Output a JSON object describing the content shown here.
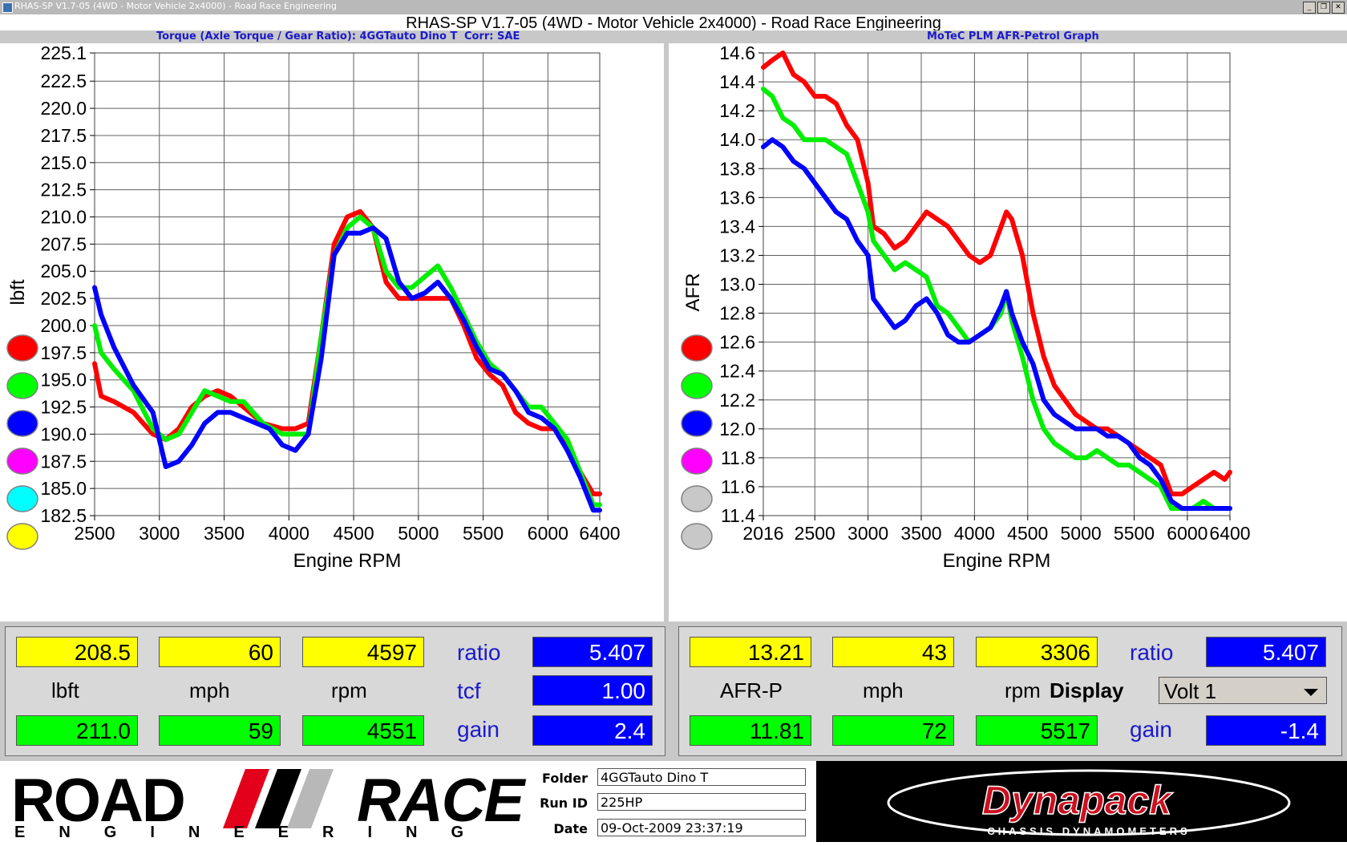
{
  "window": {
    "titlebar_text": "RHAS-SP V1.7-05   (4WD - Motor Vehicle 2x4000) - Road Race Engineering",
    "main_title": "RHAS-SP V1.7-05   (4WD - Motor Vehicle 2x4000) - Road Race Engineering",
    "minimize": "_",
    "restore": "❐",
    "close": "✕"
  },
  "left_header": {
    "title": "Torque (Axle Torque / Gear Ratio): 4GGTauto Dino T",
    "corr": "Corr: SAE"
  },
  "right_header": {
    "title": "MoTeC PLM AFR-Petrol Graph"
  },
  "chart_data": [
    {
      "type": "line",
      "xlabel": "Engine RPM",
      "ylabel": "lbft",
      "xlim": [
        2500,
        6400
      ],
      "ylim": [
        182.5,
        225.1
      ],
      "xticks": [
        2500,
        3000,
        3500,
        4000,
        4500,
        5000,
        5500,
        6000,
        6400
      ],
      "xticklabels": [
        "2500",
        "3000",
        "3500",
        "4000",
        "4500",
        "5000",
        "5500",
        "6000",
        "6400"
      ],
      "yticks": [
        182.5,
        185.0,
        187.5,
        190.0,
        192.5,
        195.0,
        197.5,
        200.0,
        202.5,
        205.0,
        207.5,
        210.0,
        212.5,
        215.0,
        217.5,
        220.0,
        222.5,
        225.1
      ],
      "yticklabels": [
        "182.5",
        "185.0",
        "187.5",
        "190.0",
        "192.5",
        "195.0",
        "197.5",
        "200.0",
        "202.5",
        "205.0",
        "207.5",
        "210.0",
        "212.5",
        "215.0",
        "217.5",
        "220.0",
        "222.5",
        "225.1"
      ],
      "grid": true,
      "series": [
        {
          "color": "#ff0000",
          "x": [
            2500,
            2550,
            2650,
            2800,
            2950,
            3050,
            3150,
            3250,
            3350,
            3450,
            3550,
            3650,
            3800,
            3950,
            4050,
            4150,
            4250,
            4350,
            4450,
            4550,
            4650,
            4750,
            4850,
            4950,
            5050,
            5150,
            5250,
            5350,
            5450,
            5550,
            5650,
            5750,
            5850,
            5950,
            6050,
            6150,
            6250,
            6350,
            6400
          ],
          "y": [
            196.5,
            193.5,
            193,
            192,
            190,
            189.5,
            190.5,
            192.5,
            193.5,
            194,
            193.5,
            192.5,
            191,
            190.5,
            190.5,
            191,
            199,
            207.5,
            210,
            210.5,
            209,
            204,
            202.5,
            202.5,
            202.5,
            202.5,
            202.5,
            200,
            197,
            195.5,
            194.5,
            192,
            191,
            190.5,
            190.5,
            189,
            186.5,
            184.5,
            184.5
          ]
        },
        {
          "color": "#00ee00",
          "x": [
            2500,
            2550,
            2650,
            2800,
            2950,
            3050,
            3150,
            3250,
            3350,
            3450,
            3550,
            3650,
            3800,
            3950,
            4050,
            4150,
            4250,
            4350,
            4450,
            4550,
            4650,
            4750,
            4850,
            4950,
            5050,
            5150,
            5250,
            5350,
            5450,
            5550,
            5650,
            5750,
            5850,
            5950,
            6050,
            6150,
            6250,
            6350,
            6400
          ],
          "y": [
            200,
            197.5,
            196,
            194,
            190.5,
            189.5,
            190,
            192,
            194,
            193.5,
            193,
            193,
            191,
            190,
            190,
            190,
            199,
            206.5,
            209,
            210,
            209,
            205,
            203.5,
            203.5,
            204.5,
            205.5,
            203.5,
            201,
            198.5,
            196.5,
            195.5,
            194,
            192.5,
            192.5,
            191,
            189.5,
            186.5,
            183.5,
            183.5
          ]
        },
        {
          "color": "#0000ff",
          "x": [
            2500,
            2550,
            2650,
            2800,
            2950,
            3050,
            3150,
            3250,
            3350,
            3450,
            3550,
            3650,
            3750,
            3850,
            3950,
            4050,
            4150,
            4250,
            4350,
            4450,
            4550,
            4650,
            4750,
            4850,
            4950,
            5050,
            5150,
            5250,
            5350,
            5450,
            5550,
            5650,
            5750,
            5850,
            5950,
            6050,
            6150,
            6250,
            6350,
            6400
          ],
          "y": [
            203.5,
            201,
            198,
            194.5,
            192,
            187,
            187.5,
            189,
            191,
            192,
            192,
            191.5,
            191,
            190.5,
            189,
            188.5,
            190,
            197,
            206.5,
            208.5,
            208.5,
            209,
            208,
            204,
            202.5,
            203,
            204,
            202.5,
            200.5,
            198,
            196,
            195.5,
            194,
            192,
            191.5,
            190.5,
            188.5,
            186,
            183,
            183
          ]
        }
      ]
    },
    {
      "type": "line",
      "xlabel": "Engine RPM",
      "ylabel": "AFR",
      "xlim": [
        2016,
        6400
      ],
      "ylim": [
        11.4,
        14.6
      ],
      "xticks": [
        2016,
        2500,
        3000,
        3500,
        4000,
        4500,
        5000,
        5500,
        6000,
        6400
      ],
      "xticklabels": [
        "2016",
        "2500",
        "3000",
        "3500",
        "4000",
        "4500",
        "5000",
        "5500",
        "6000",
        "6400"
      ],
      "yticks": [
        11.4,
        11.6,
        11.8,
        12.0,
        12.2,
        12.4,
        12.6,
        12.8,
        13.0,
        13.2,
        13.4,
        13.6,
        13.8,
        14.0,
        14.2,
        14.4,
        14.6
      ],
      "yticklabels": [
        "11.4",
        "11.6",
        "11.8",
        "12.0",
        "12.2",
        "12.4",
        "12.6",
        "12.8",
        "13.0",
        "13.2",
        "13.4",
        "13.6",
        "13.8",
        "14.0",
        "14.2",
        "14.4",
        "14.6"
      ],
      "grid": true,
      "series": [
        {
          "color": "#ff0000",
          "x": [
            2016,
            2100,
            2200,
            2300,
            2400,
            2500,
            2600,
            2700,
            2800,
            2900,
            3000,
            3050,
            3150,
            3250,
            3350,
            3450,
            3550,
            3650,
            3750,
            3850,
            3950,
            4050,
            4150,
            4250,
            4300,
            4350,
            4450,
            4550,
            4650,
            4750,
            4850,
            4950,
            5050,
            5150,
            5250,
            5350,
            5450,
            5550,
            5650,
            5750,
            5850,
            5950,
            6050,
            6150,
            6250,
            6350,
            6400
          ],
          "y": [
            14.5,
            14.55,
            14.6,
            14.45,
            14.4,
            14.3,
            14.3,
            14.25,
            14.1,
            14.0,
            13.7,
            13.4,
            13.35,
            13.25,
            13.3,
            13.4,
            13.5,
            13.45,
            13.4,
            13.3,
            13.2,
            13.15,
            13.2,
            13.4,
            13.5,
            13.45,
            13.2,
            12.8,
            12.5,
            12.3,
            12.2,
            12.1,
            12.05,
            12.0,
            12.0,
            11.95,
            11.9,
            11.85,
            11.8,
            11.75,
            11.55,
            11.55,
            11.6,
            11.65,
            11.7,
            11.65,
            11.7
          ]
        },
        {
          "color": "#00ee00",
          "x": [
            2016,
            2100,
            2200,
            2300,
            2400,
            2500,
            2600,
            2700,
            2800,
            2900,
            3000,
            3050,
            3150,
            3250,
            3350,
            3450,
            3550,
            3650,
            3750,
            3850,
            3950,
            4050,
            4150,
            4250,
            4300,
            4350,
            4450,
            4550,
            4650,
            4750,
            4850,
            4950,
            5050,
            5150,
            5250,
            5350,
            5450,
            5550,
            5650,
            5750,
            5850,
            5950,
            6050,
            6150,
            6250,
            6350,
            6400
          ],
          "y": [
            14.35,
            14.3,
            14.15,
            14.1,
            14.0,
            14.0,
            14.0,
            13.95,
            13.9,
            13.7,
            13.5,
            13.3,
            13.2,
            13.1,
            13.15,
            13.1,
            13.05,
            12.85,
            12.8,
            12.7,
            12.6,
            12.65,
            12.7,
            12.8,
            12.95,
            12.75,
            12.5,
            12.2,
            12.0,
            11.9,
            11.85,
            11.8,
            11.8,
            11.85,
            11.8,
            11.75,
            11.75,
            11.7,
            11.65,
            11.6,
            11.45,
            11.45,
            11.45,
            11.5,
            11.45,
            11.45,
            11.45
          ]
        },
        {
          "color": "#0000ff",
          "x": [
            2016,
            2100,
            2200,
            2300,
            2400,
            2500,
            2600,
            2700,
            2800,
            2900,
            3000,
            3050,
            3150,
            3250,
            3350,
            3450,
            3550,
            3650,
            3750,
            3850,
            3950,
            4050,
            4150,
            4250,
            4300,
            4350,
            4450,
            4550,
            4650,
            4750,
            4850,
            4950,
            5050,
            5150,
            5250,
            5350,
            5450,
            5550,
            5650,
            5750,
            5850,
            5950,
            6050,
            6150,
            6250,
            6350,
            6400
          ],
          "y": [
            13.95,
            14.0,
            13.95,
            13.85,
            13.8,
            13.7,
            13.6,
            13.5,
            13.45,
            13.3,
            13.2,
            12.9,
            12.8,
            12.7,
            12.75,
            12.85,
            12.9,
            12.8,
            12.65,
            12.6,
            12.6,
            12.65,
            12.7,
            12.85,
            12.95,
            12.8,
            12.6,
            12.45,
            12.2,
            12.1,
            12.05,
            12.0,
            12.0,
            12.0,
            11.95,
            11.95,
            11.9,
            11.8,
            11.75,
            11.65,
            11.5,
            11.45,
            11.45,
            11.45,
            11.45,
            11.45,
            11.45
          ]
        }
      ]
    }
  ],
  "left_legend_colors": [
    "#ff0000",
    "#00ff00",
    "#0000ff",
    "#ff00ff",
    "#00ffff",
    "#ffff00"
  ],
  "right_legend_colors": [
    "#ff0000",
    "#00ff00",
    "#0000ff",
    "#ff00ff",
    "#c8c8c8",
    "#c8c8c8"
  ],
  "left_readout": {
    "yellow": [
      "208.5",
      "60",
      "4597"
    ],
    "units": [
      "lbft",
      "mph",
      "rpm"
    ],
    "green": [
      "211.0",
      "59",
      "4551"
    ],
    "ratio_label": "ratio",
    "ratio": "5.407",
    "tcf_label": "tcf",
    "tcf": "1.00",
    "gain_label": "gain",
    "gain": "2.4"
  },
  "right_readout": {
    "yellow": [
      "13.21",
      "43",
      "3306"
    ],
    "units": [
      "AFR-P",
      "mph",
      "rpm"
    ],
    "green": [
      "11.81",
      "72",
      "5517"
    ],
    "ratio_label": "ratio",
    "ratio": "5.407",
    "display_label": "Display",
    "display_value": "Volt 1",
    "gain_label": "gain",
    "gain": "-1.4"
  },
  "footer": {
    "logo_road": "ROAD",
    "logo_race": "RACE",
    "logo_eng": "ENGINEERING",
    "folder_label": "Folder",
    "folder": "4GGTauto Dino T",
    "runid_label": "Run ID",
    "runid": "225HP",
    "date_label": "Date",
    "date": "09-Oct-2009  23:37:19",
    "brand": "Dynapack",
    "brand_sub": "CHASSIS DYNAMOMETERS"
  }
}
